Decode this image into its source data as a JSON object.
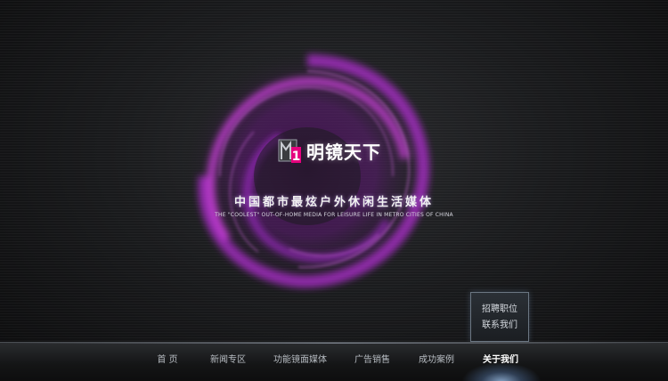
{
  "brand": {
    "name": "明镜天下",
    "logo_mark_digit": "1"
  },
  "slogan": {
    "chinese": "中国都市最炫户外休闲生活媒体",
    "english": "THE \"COOLEST\" OUT-OF-HOME MEDIA FOR LEISURE LIFE IN METRO CITIES OF CHINA"
  },
  "submenu": {
    "items": [
      {
        "label": "招聘职位"
      },
      {
        "label": "联系我们"
      }
    ]
  },
  "nav": {
    "items": [
      {
        "label": "首  页",
        "active": false
      },
      {
        "label": "新闻专区",
        "active": false
      },
      {
        "label": "功能镜面媒体",
        "active": false
      },
      {
        "label": "广告销售",
        "active": false
      },
      {
        "label": "成功案例",
        "active": false
      },
      {
        "label": "关于我们",
        "active": true
      }
    ]
  },
  "colors": {
    "swirl_accent": "#c03ad8",
    "logo_accent": "#e6007e",
    "active_glow": "#aad2ff"
  }
}
